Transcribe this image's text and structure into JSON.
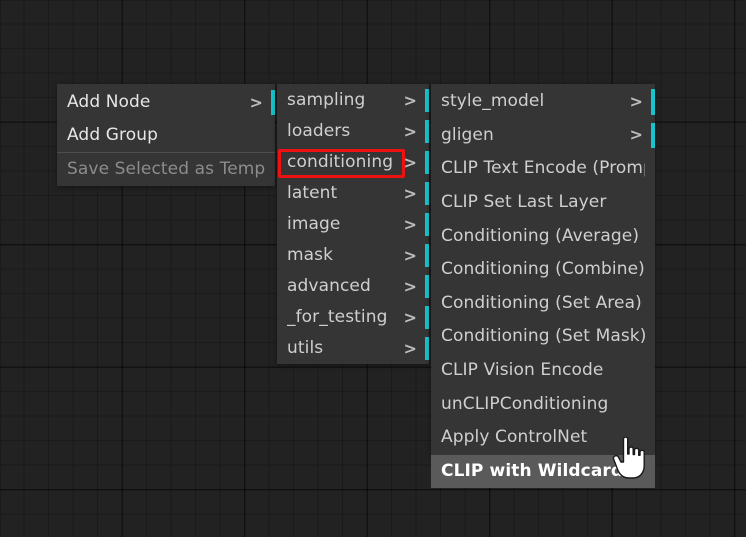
{
  "app": {
    "canvas_background": "#222222",
    "menu_background": "#353535",
    "accent_color": "#17c3cc",
    "highlight_color": "#ee1111",
    "selected_color": "#5a5a5a"
  },
  "menus": {
    "root": {
      "items": [
        {
          "label": "Add Node",
          "arrow": ">",
          "has_submenu": true,
          "state": "bright",
          "separator_after": false
        },
        {
          "label": "Add Group",
          "arrow": "",
          "has_submenu": false,
          "state": "bright",
          "separator_after": true
        },
        {
          "label": "Save Selected as Template",
          "arrow": "",
          "has_submenu": false,
          "state": "dim",
          "separator_after": false
        }
      ]
    },
    "categories": {
      "items": [
        {
          "label": "sampling",
          "arrow": ">",
          "has_submenu": true,
          "state": "normal"
        },
        {
          "label": "loaders",
          "arrow": ">",
          "has_submenu": true,
          "state": "normal"
        },
        {
          "label": "conditioning",
          "arrow": ">",
          "has_submenu": true,
          "state": "normal",
          "annotated": true
        },
        {
          "label": "latent",
          "arrow": ">",
          "has_submenu": true,
          "state": "normal"
        },
        {
          "label": "image",
          "arrow": ">",
          "has_submenu": true,
          "state": "normal"
        },
        {
          "label": "mask",
          "arrow": ">",
          "has_submenu": true,
          "state": "normal"
        },
        {
          "label": "advanced",
          "arrow": ">",
          "has_submenu": true,
          "state": "normal"
        },
        {
          "label": "_for_testing",
          "arrow": ">",
          "has_submenu": true,
          "state": "normal"
        },
        {
          "label": "utils",
          "arrow": ">",
          "has_submenu": true,
          "state": "normal"
        }
      ]
    },
    "nodes": {
      "items": [
        {
          "label": "style_model",
          "arrow": ">",
          "has_submenu": true,
          "state": "normal"
        },
        {
          "label": "gligen",
          "arrow": ">",
          "has_submenu": true,
          "state": "normal"
        },
        {
          "label": "CLIP Text Encode (Prompt)",
          "arrow": "",
          "has_submenu": false,
          "state": "normal"
        },
        {
          "label": "CLIP Set Last Layer",
          "arrow": "",
          "has_submenu": false,
          "state": "normal"
        },
        {
          "label": "Conditioning (Average)",
          "arrow": "",
          "has_submenu": false,
          "state": "normal"
        },
        {
          "label": "Conditioning (Combine)",
          "arrow": "",
          "has_submenu": false,
          "state": "normal"
        },
        {
          "label": "Conditioning (Set Area)",
          "arrow": "",
          "has_submenu": false,
          "state": "normal"
        },
        {
          "label": "Conditioning (Set Mask)",
          "arrow": "",
          "has_submenu": false,
          "state": "normal"
        },
        {
          "label": "CLIP Vision Encode",
          "arrow": "",
          "has_submenu": false,
          "state": "normal"
        },
        {
          "label": "unCLIPConditioning",
          "arrow": "",
          "has_submenu": false,
          "state": "normal"
        },
        {
          "label": "Apply ControlNet",
          "arrow": "",
          "has_submenu": false,
          "state": "normal"
        },
        {
          "label": "CLIP with Wildcards",
          "arrow": "",
          "has_submenu": false,
          "state": "selected"
        }
      ]
    }
  },
  "cursor": {
    "type": "pointer-hand-cursor"
  }
}
